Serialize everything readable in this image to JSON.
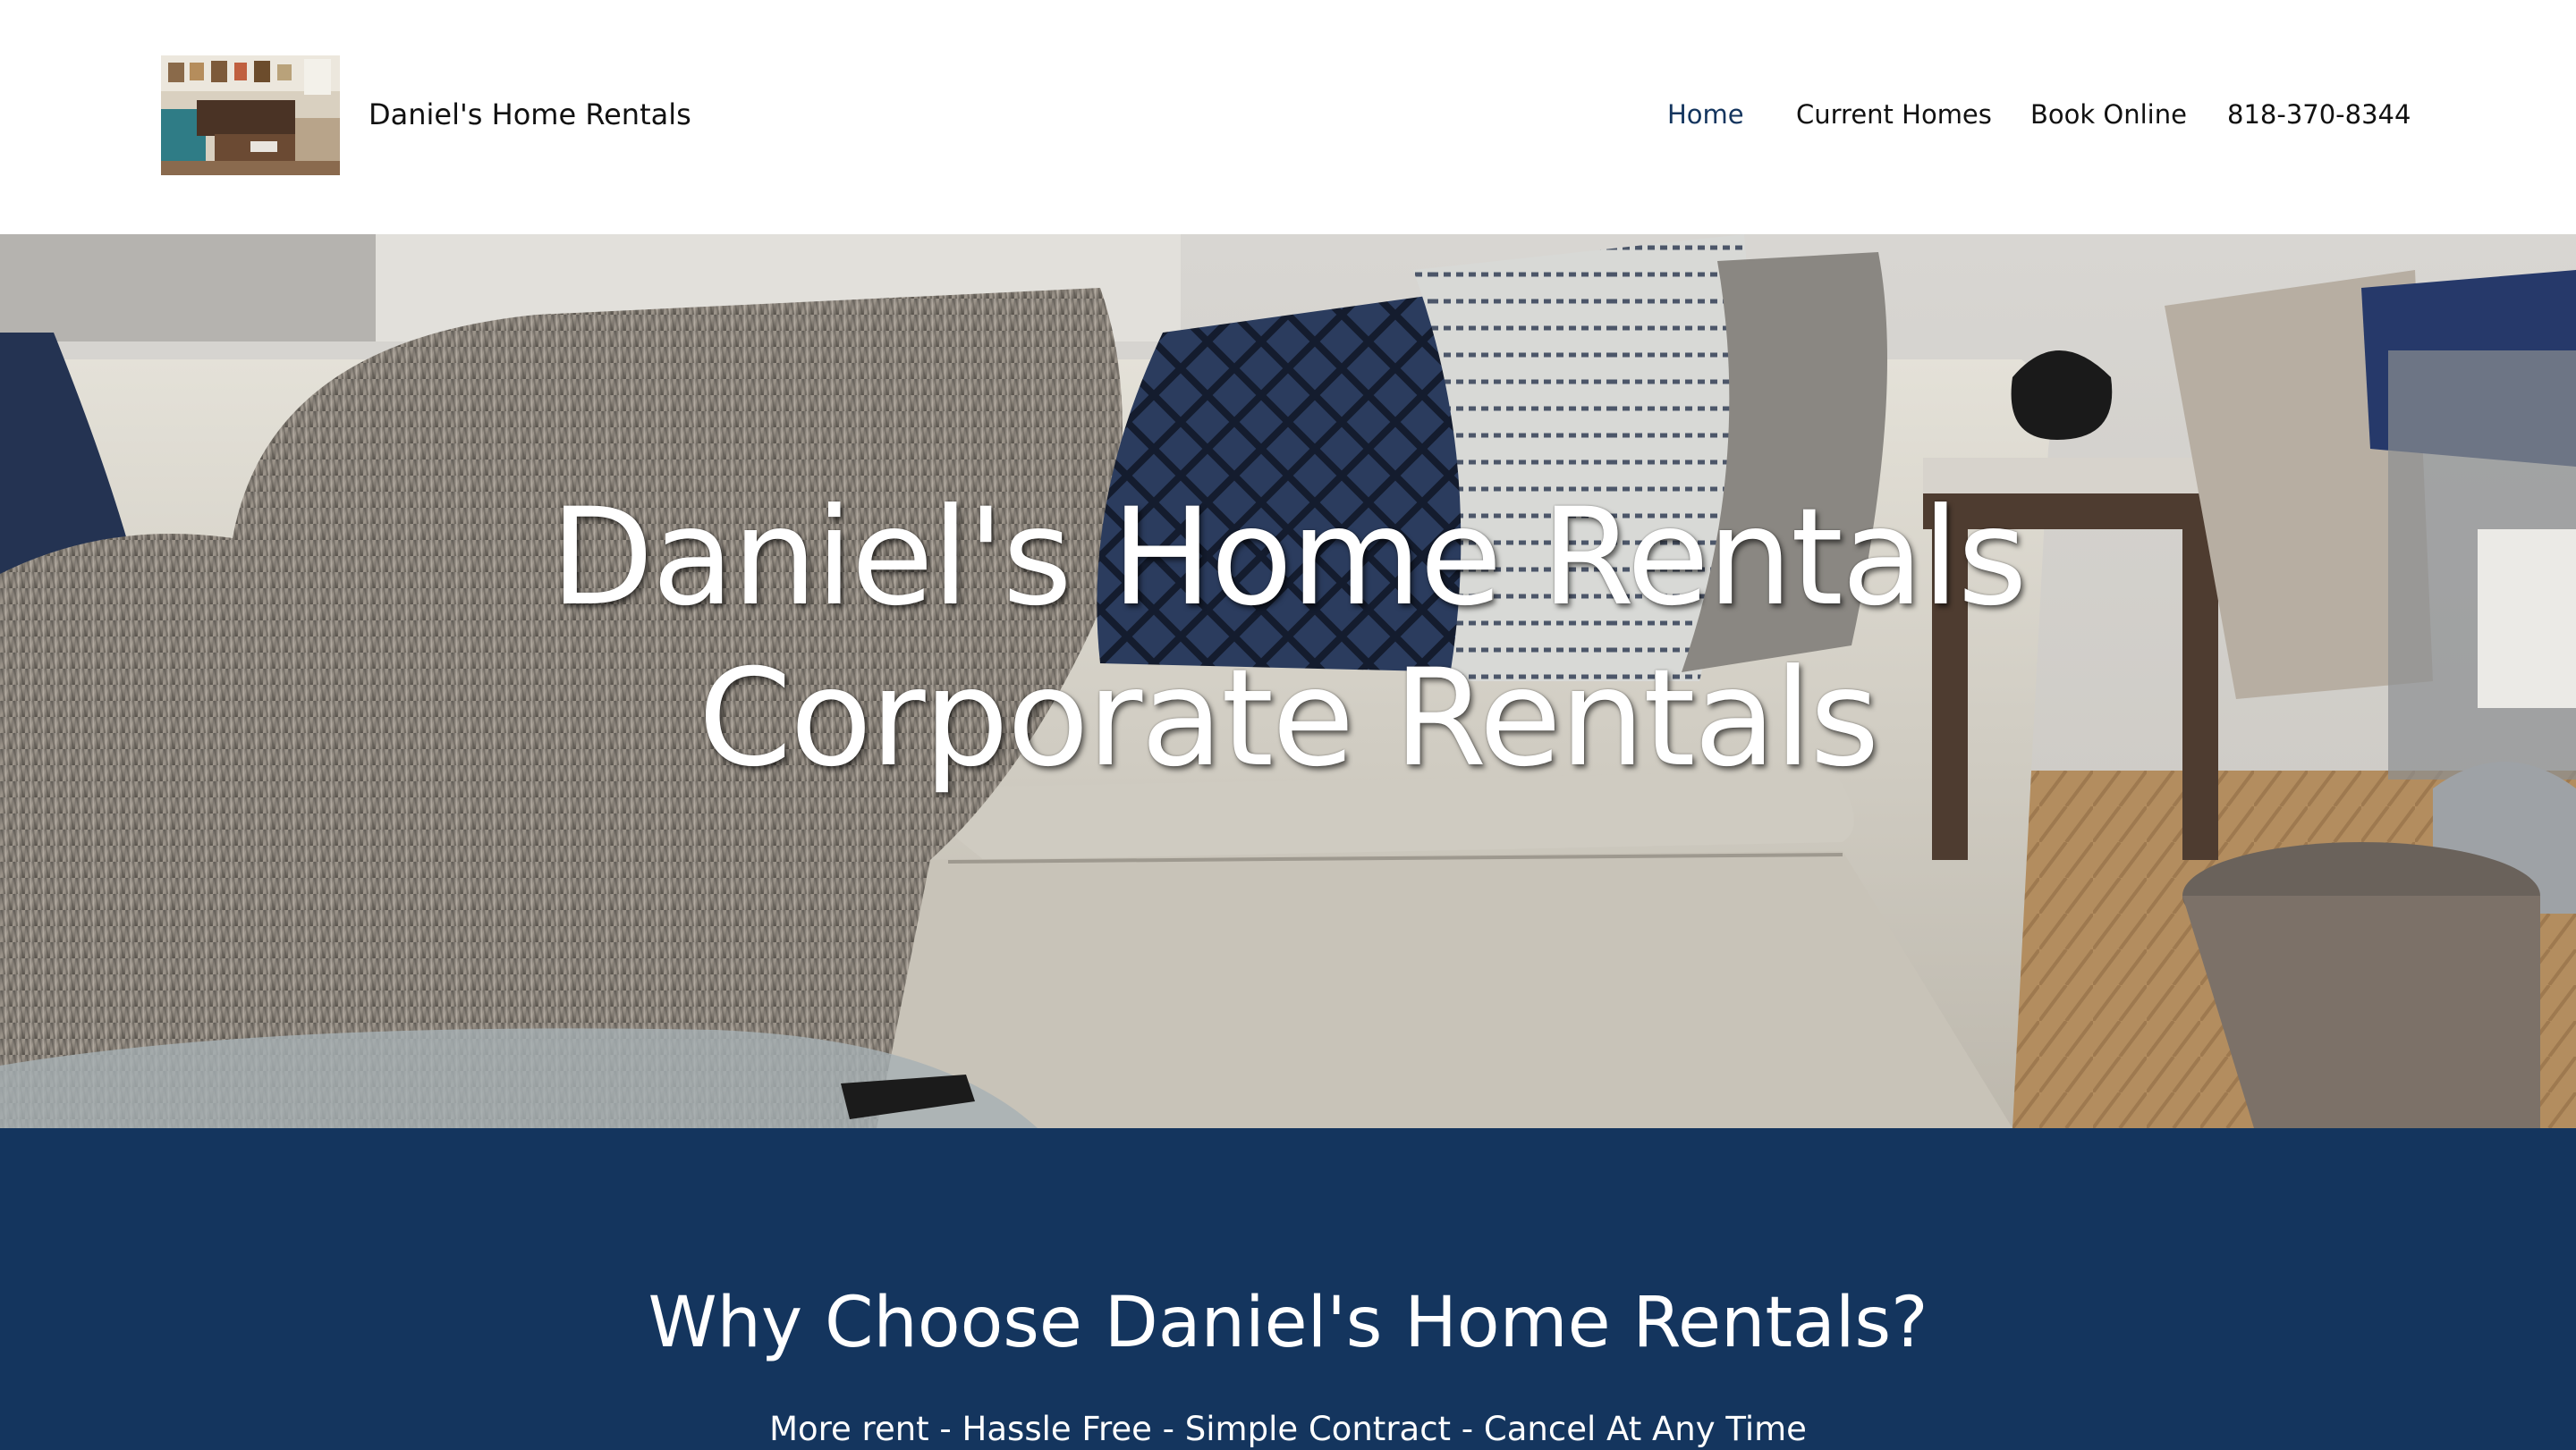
{
  "header": {
    "brand_name": "Daniel's Home Rentals",
    "logo": "living-room-photo-thumbnail"
  },
  "nav": {
    "items": [
      {
        "label": "Home",
        "active": true
      },
      {
        "label": "Current Homes",
        "active": false
      },
      {
        "label": "Book Online",
        "active": false
      },
      {
        "label": "818-370-8344",
        "active": false
      }
    ]
  },
  "hero": {
    "title_line1": "Daniel's Home Rentals",
    "title_line2": "Corporate Rentals",
    "background": "living-room-sofa-photo"
  },
  "why": {
    "title": "Why Choose Daniel's Home Rentals?",
    "subtitle": "More rent - Hassle Free - Simple Contract - Cancel At Any Time"
  },
  "colors": {
    "brand_navy": "#14355e",
    "active_nav": "#14355e",
    "text": "#111111",
    "white": "#ffffff"
  }
}
